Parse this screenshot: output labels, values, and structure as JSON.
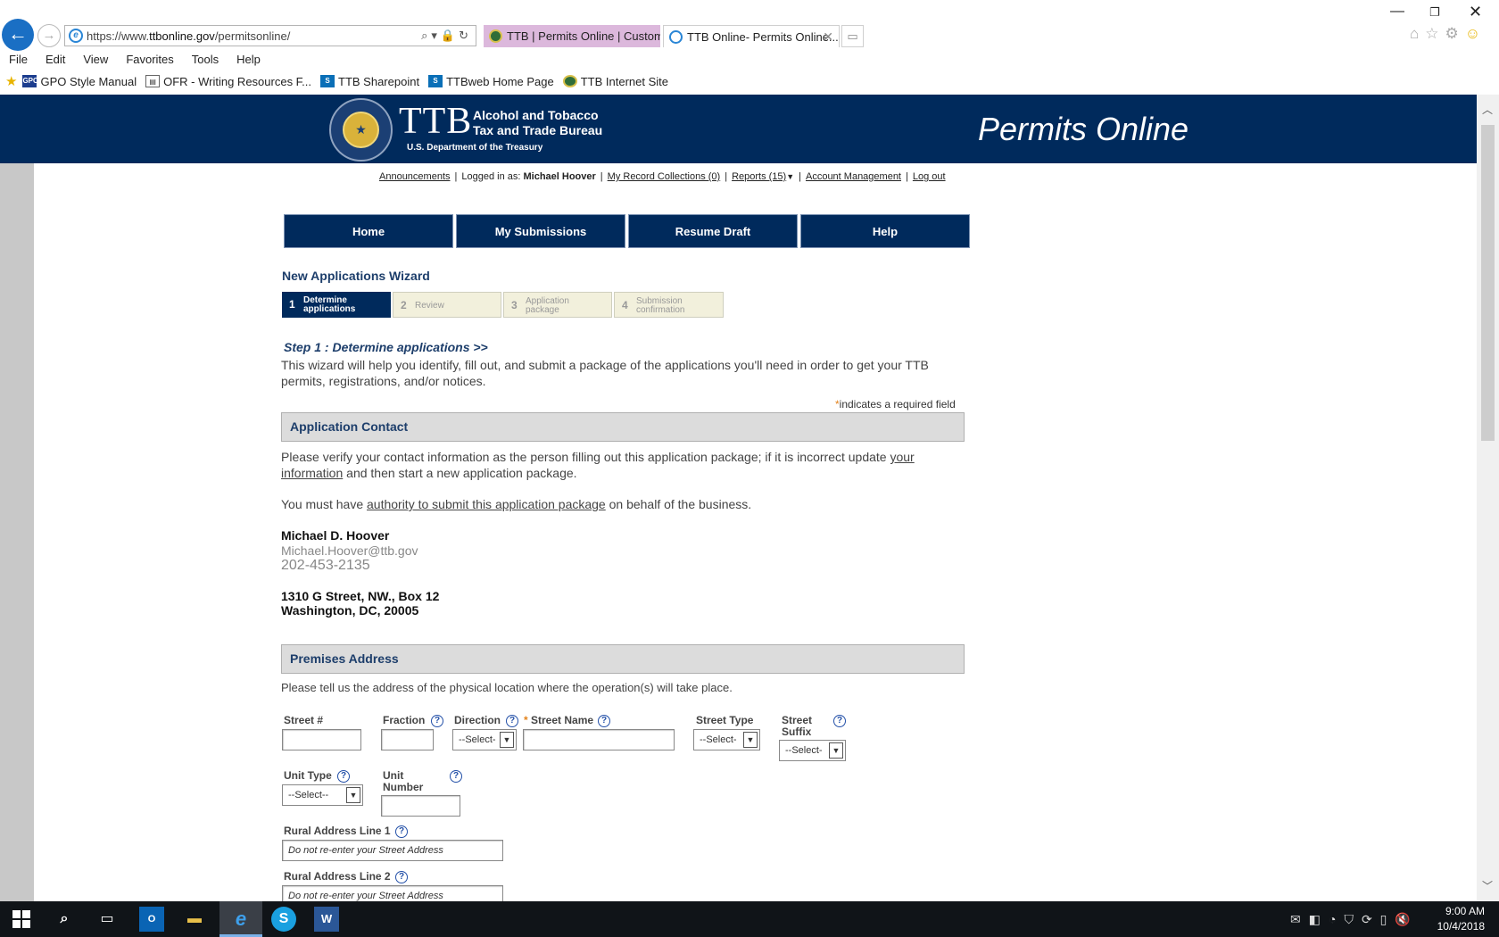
{
  "browser": {
    "url_prefix": "https://www.",
    "url_domain": "ttbonline.gov",
    "url_path": "/permitsonline/",
    "tabs": [
      {
        "title": "TTB | Permits Online | Custom..."
      },
      {
        "title": "TTB Online- Permits Online..."
      }
    ],
    "menu": [
      "File",
      "Edit",
      "View",
      "Favorites",
      "Tools",
      "Help"
    ],
    "favorites": [
      {
        "label": "GPO Style Manual",
        "icon_text": "GPO"
      },
      {
        "label": "OFR - Writing Resources F..."
      },
      {
        "label": "TTB Sharepoint",
        "icon_text": "S"
      },
      {
        "label": "TTBweb Home Page",
        "icon_text": "S"
      },
      {
        "label": "TTB Internet Site"
      }
    ]
  },
  "banner": {
    "acronym": "TTB",
    "name_line1": "Alcohol and Tobacco",
    "name_line2": "Tax and Trade Bureau",
    "department": "U.S. Department of the Treasury",
    "app_title": "Permits Online"
  },
  "toplinks": {
    "announcements": "Announcements",
    "logged_in_label": "Logged in as:",
    "user": "Michael Hoover",
    "record_collections": "My Record Collections (0)",
    "reports": "Reports (15)",
    "account": "Account Management",
    "logout": "Log out"
  },
  "nav": [
    "Home",
    "My Submissions",
    "Resume Draft",
    "Help"
  ],
  "wizard": {
    "title": "New Applications Wizard",
    "steps": [
      {
        "num": "1",
        "line1": "Determine",
        "line2": "applications"
      },
      {
        "num": "2",
        "line1": "Review"
      },
      {
        "num": "3",
        "line1": "Application",
        "line2": "package"
      },
      {
        "num": "4",
        "line1": "Submission",
        "line2": "confirmation"
      }
    ],
    "step_heading": "Step 1 : Determine applications >>",
    "intro": "This wizard will help you identify, fill out, and submit a package of the applications you'll need in order to get your TTB permits, registrations, and/or notices.",
    "required_marker": "*",
    "required_note": "indicates a required field"
  },
  "contact": {
    "section_title": "Application Contact",
    "verify_text_before": "Please verify your contact information as the person filling out this application package; if it is incorrect update ",
    "verify_link": "your information",
    "verify_text_after": " and then start a new application package.",
    "authority_before": "You must have ",
    "authority_link": "authority to submit this application package",
    "authority_after": " on behalf of the business.",
    "name": "Michael D. Hoover",
    "email": "Michael.Hoover@ttb.gov",
    "phone": "202-453-2135",
    "address_line1": "1310 G Street, NW., Box 12",
    "address_line2": "Washington, DC, 20005"
  },
  "premises": {
    "section_title": "Premises Address",
    "instructions": "Please tell us the address of the physical location where the operation(s) will take place.",
    "labels": {
      "street_num": "Street #",
      "fraction": "Fraction",
      "direction": "Direction",
      "street_name": "Street Name",
      "street_type": "Street Type",
      "street_suffix_1": "Street",
      "street_suffix_2": "Suffix",
      "unit_type": "Unit Type",
      "unit_number_1": "Unit",
      "unit_number_2": "Number",
      "rural1": "Rural Address Line 1",
      "rural2": "Rural Address Line 2"
    },
    "select_placeholder": "--Select--",
    "direction_placeholder": "--Select-",
    "suffix_placeholder": "--Select-",
    "street_type_placeholder": "--Select-",
    "rural_placeholder": "Do not re-enter your Street Address",
    "help_glyph": "?"
  },
  "taskbar": {
    "time": "9:00 AM",
    "date": "10/4/2018"
  }
}
